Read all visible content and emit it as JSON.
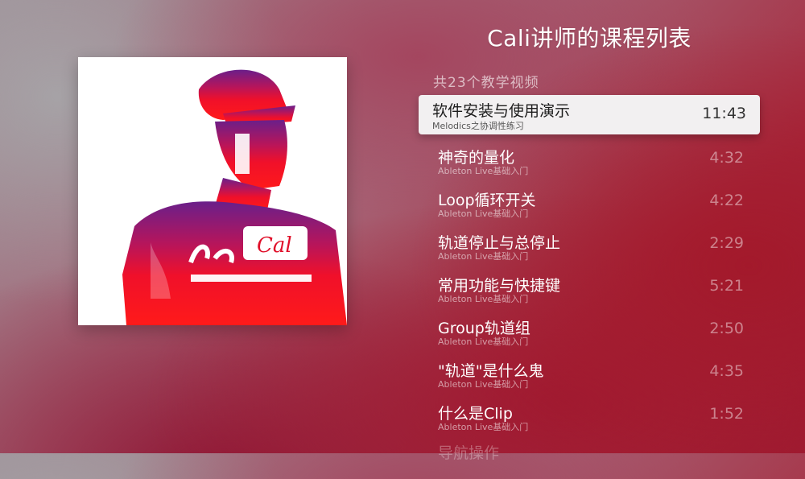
{
  "page": {
    "title": "Cali讲师的课程列表"
  },
  "list": {
    "count_label": "共23个教学视频",
    "items": [
      {
        "title": "软件安装与使用演示",
        "subtitle": "Melodics之协调性练习",
        "duration": "11:43"
      },
      {
        "title": "神奇的量化",
        "subtitle": "Ableton Live基础入门",
        "duration": "4:32"
      },
      {
        "title": "Loop循环开关",
        "subtitle": "Ableton Live基础入门",
        "duration": "4:22"
      },
      {
        "title": "轨道停止与总停止",
        "subtitle": "Ableton Live基础入门",
        "duration": "2:29"
      },
      {
        "title": "常用功能与快捷键",
        "subtitle": "Ableton Live基础入门",
        "duration": "5:21"
      },
      {
        "title": "Group轨道组",
        "subtitle": "Ableton Live基础入门",
        "duration": "2:50"
      },
      {
        "title": "\"轨道\"是什么鬼",
        "subtitle": "Ableton Live基础入门",
        "duration": "4:35"
      },
      {
        "title": "什么是Clip",
        "subtitle": "Ableton Live基础入门",
        "duration": "1:52"
      },
      {
        "title": "导航操作"
      }
    ]
  },
  "artwork": {
    "shirt_text": "Cal",
    "colors": {
      "top": "#6a1f8a",
      "bottom": "#ff1a1a"
    }
  }
}
